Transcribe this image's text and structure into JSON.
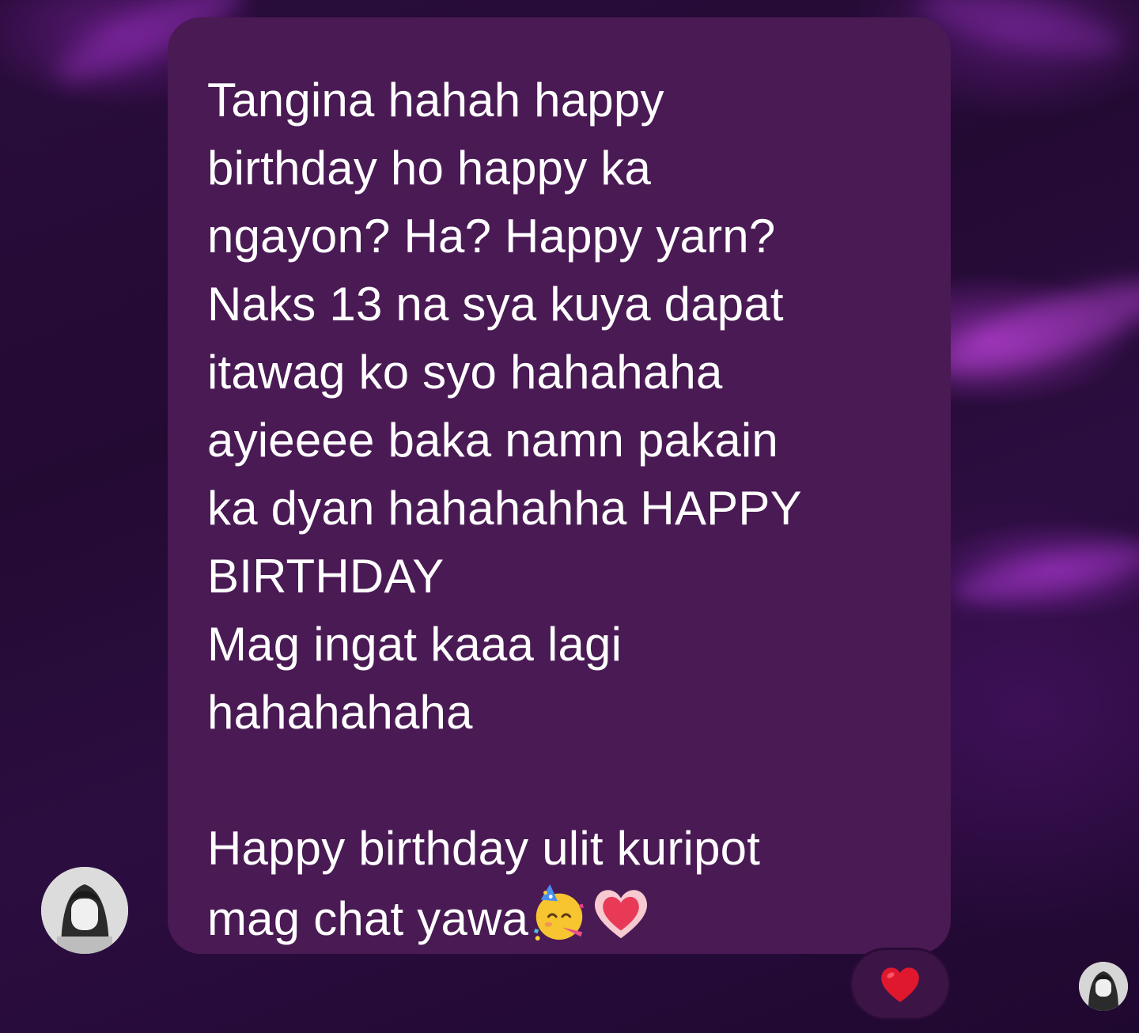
{
  "message": {
    "text": "Tangina hahah happy\nbirthday ho happy ka\nngayon? Ha? Happy yarn?\nNaks 13 na sya kuya dapat\nitawag ko syo hahahaha\nayieeee baka namn pakain\nka dyan hahahahha HAPPY\nBIRTHDAY\nMag ingat kaaa lagi\nhahahahaha\n\nHappy birthday ulit kuripot\nmag chat yawa",
    "emojis": [
      "partying-face-icon",
      "growing-heart-icon"
    ]
  },
  "reaction": {
    "icon": "red-heart-icon"
  },
  "colors": {
    "bubble": "#4a1a54",
    "text": "#ffffff",
    "reaction_heart": "#e0182e"
  }
}
